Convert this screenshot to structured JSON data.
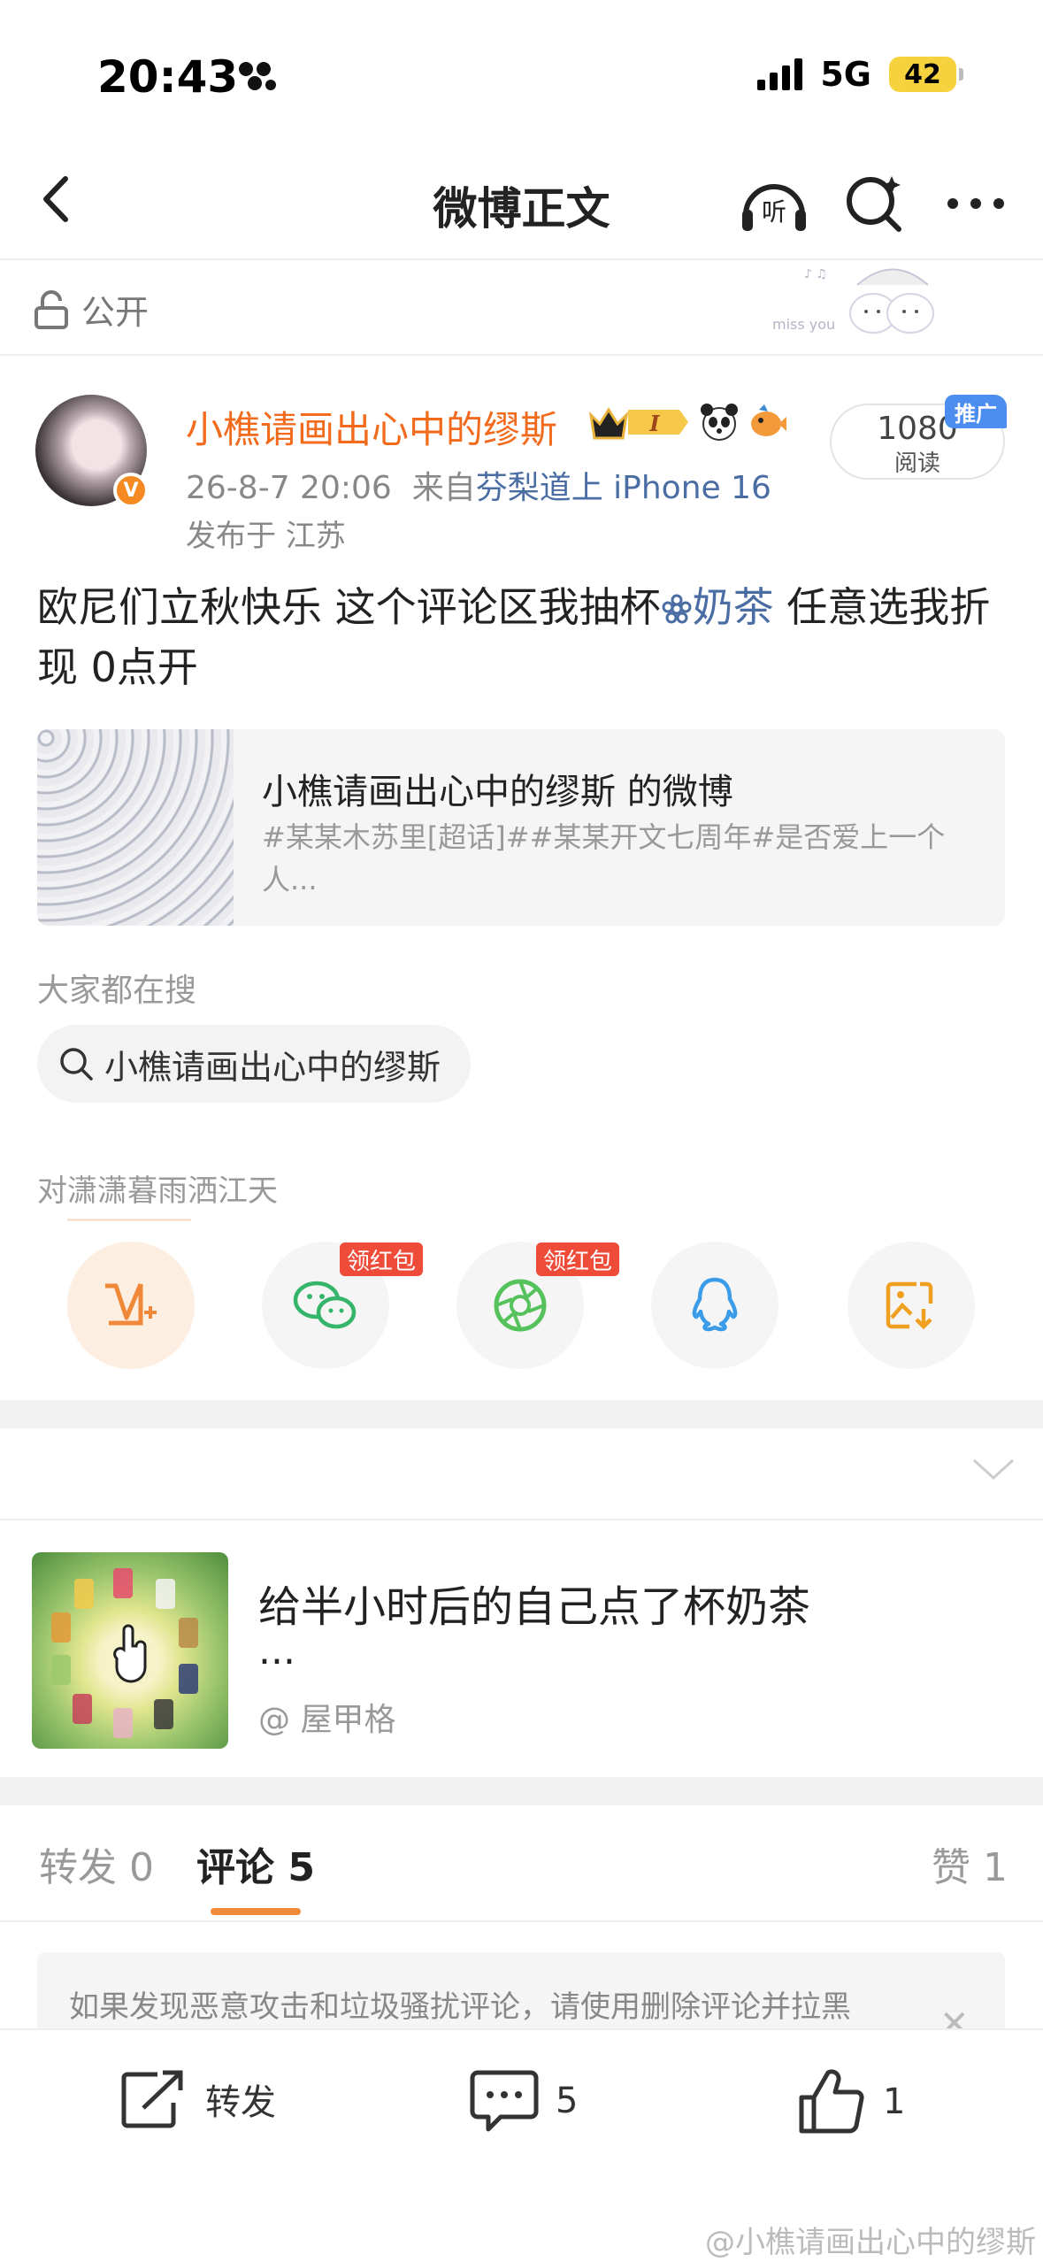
{
  "status_bar": {
    "time": "20:43",
    "network": "5G",
    "battery": "42"
  },
  "nav": {
    "title": "微博正文"
  },
  "visibility": {
    "label": "公开"
  },
  "post": {
    "username": "小樵请画出心中的缪斯",
    "badge_level": "I",
    "date": "26-8-7 20:06",
    "source_prefix": "来自",
    "source": "芬梨道上 iPhone 16",
    "location": "发布于 江苏",
    "views_count": "1080",
    "views_label": "阅读",
    "promo_tag": "推广",
    "text_part1": "欧尼们立秋快乐 这个评论区我抽杯",
    "text_link": "奶茶",
    "text_part2": " 任意选我折现 0点开"
  },
  "quote_card": {
    "title": "小樵请画出心中的缪斯 的微博",
    "subtitle": "#某某木苏里[超话]##某某开文七周年#是否爱上一个人..."
  },
  "search": {
    "label": "大家都在搜",
    "query": "小樵请画出心中的缪斯"
  },
  "share": {
    "label": "对潇潇暮雨洒江天",
    "badge_wechat": "领红包",
    "badge_moments": "领红包"
  },
  "ad": {
    "title": "给半小时后的自己点了杯奶茶",
    "ellipsis": "...",
    "author": "@ 屋甲格"
  },
  "tabs": {
    "repost": "转发 0",
    "comments": "评论 5",
    "likes": "赞 1"
  },
  "notice": {
    "text": "如果发现恶意攻击和垃圾骚扰评论，请使用删除评论并拉黑"
  },
  "bottom_bar": {
    "repost_label": "转发",
    "comment_count": "5",
    "like_count": "1"
  },
  "watermark": "@小樵请画出心中的缪斯",
  "colors": {
    "accent_orange": "#f26b1c",
    "link_blue": "#4a6da4",
    "red_badge": "#ee4b39"
  }
}
